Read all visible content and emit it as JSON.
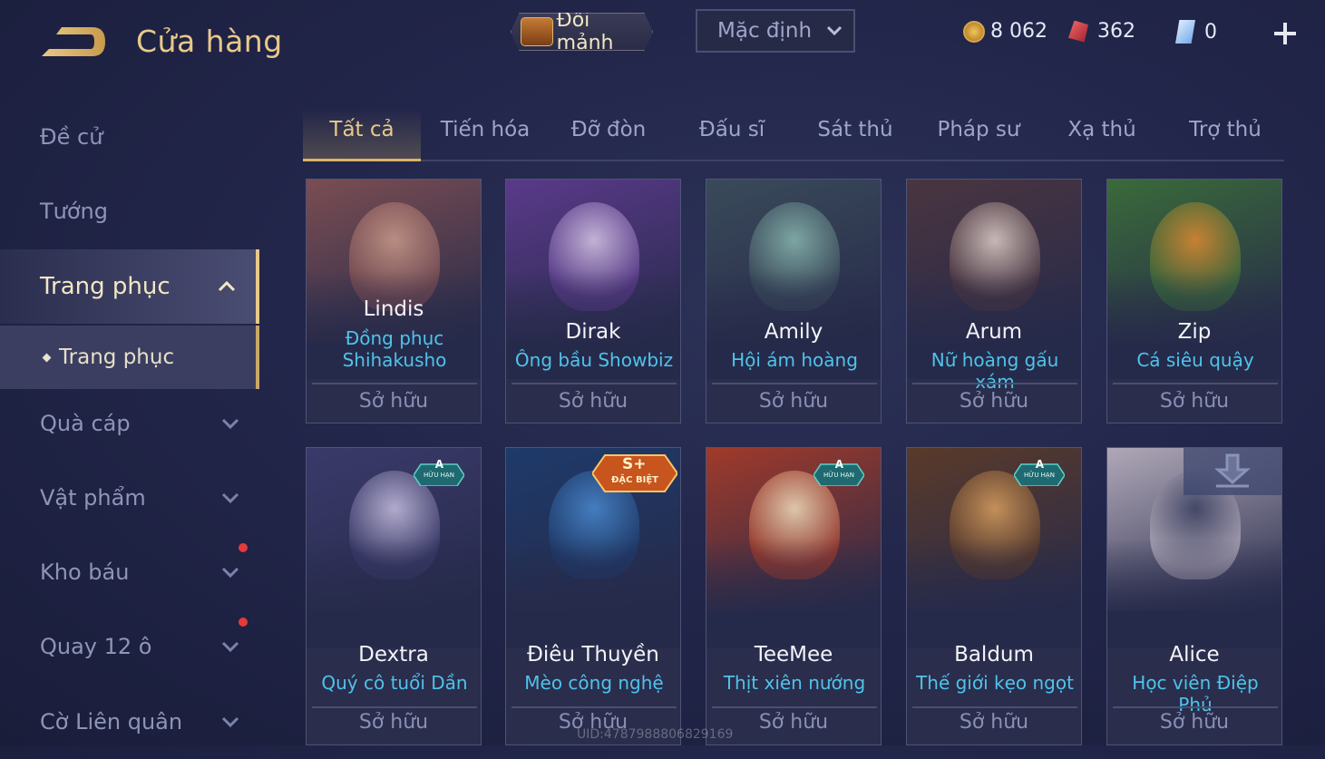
{
  "header": {
    "title": "Cửa hàng",
    "exchange_label": "Đổi mảnh",
    "sort_label": "Mặc định",
    "currencies": [
      {
        "icon": "gold-coin-icon",
        "value": "8 062"
      },
      {
        "icon": "voucher-icon",
        "value": "362"
      },
      {
        "icon": "diamond-icon",
        "value": "0"
      }
    ]
  },
  "sidebar": {
    "items": [
      {
        "label": "Đề cử"
      },
      {
        "label": "Tướng"
      },
      {
        "label": "Trang phục"
      },
      {
        "label": "Trang phục"
      },
      {
        "label": "Quà cáp"
      },
      {
        "label": "Vật phẩm"
      },
      {
        "label": "Kho báu"
      },
      {
        "label": "Quay 12 ô"
      },
      {
        "label": "Cờ Liên quân"
      }
    ]
  },
  "tabs": [
    "Tất cả",
    "Tiến hóa",
    "Đỡ đòn",
    "Đấu sĩ",
    "Sát thủ",
    "Pháp sư",
    "Xạ thủ",
    "Trợ thủ"
  ],
  "cards": [
    {
      "hero": "Lindis",
      "skin": "Đồng phục Shihakusho",
      "status": "Sở hữu",
      "badge": "",
      "colors": [
        "#7a4d52",
        "#c89a8a"
      ]
    },
    {
      "hero": "Dirak",
      "skin": "Ông bầu Showbiz",
      "status": "Sở hữu",
      "badge": "",
      "colors": [
        "#5a3a8a",
        "#d8c8e8"
      ]
    },
    {
      "hero": "Amily",
      "skin": "Hội ám hoàng",
      "status": "Sở hữu",
      "badge": "",
      "colors": [
        "#3a4a5a",
        "#8ab8b0"
      ]
    },
    {
      "hero": "Arum",
      "skin": "Nữ hoàng gấu xám",
      "status": "Sở hữu",
      "badge": "",
      "colors": [
        "#4a3540",
        "#e0d0c8"
      ]
    },
    {
      "hero": "Zip",
      "skin": "Cá siêu quậy",
      "status": "Sở hữu",
      "badge": "",
      "colors": [
        "#3a6a3a",
        "#e08a30"
      ]
    },
    {
      "hero": "Dextra",
      "skin": "Quý cô tuổi Dần",
      "status": "Sở hữu",
      "badge": "A",
      "badge_sub": "HỮU HẠN",
      "colors": [
        "#3a3a6a",
        "#c8c0e0"
      ]
    },
    {
      "hero": "Điêu Thuyền",
      "skin": "Mèo công nghệ",
      "status": "Sở hữu",
      "badge": "S+",
      "badge_sub": "ĐẶC BIỆT",
      "colors": [
        "#1e3a6a",
        "#4a8ad0"
      ]
    },
    {
      "hero": "TeeMee",
      "skin": "Thịt xiên nướng",
      "status": "Sở hữu",
      "badge": "A",
      "badge_sub": "HỮU HẠN",
      "colors": [
        "#a03a2a",
        "#f0e0c0"
      ]
    },
    {
      "hero": "Baldum",
      "skin": "Thế giới kẹo ngọt",
      "status": "Sở hữu",
      "badge": "A",
      "badge_sub": "HỮU HẠN",
      "colors": [
        "#5a3a2a",
        "#d8a060"
      ]
    },
    {
      "hero": "Alice",
      "skin": "Học viên Điệp Phủ",
      "status": "Sở hữu",
      "badge": "",
      "colors": [
        "#b0a8b8",
        "#3a4060"
      ]
    }
  ],
  "footer": {
    "uid": "UID:4787988806829169"
  }
}
